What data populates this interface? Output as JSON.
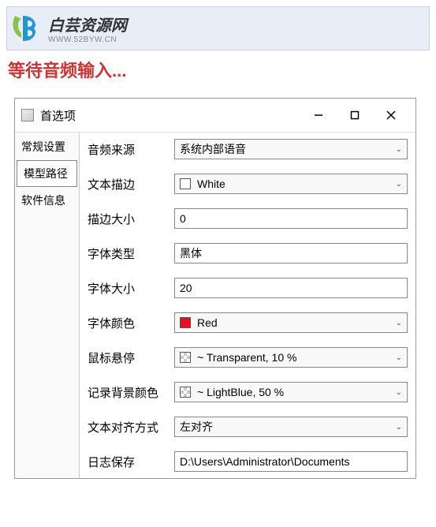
{
  "banner": {
    "logo_cn": "白芸资源网",
    "logo_url": "WWW.52BYW.CN"
  },
  "status": "等待音频输入...",
  "window": {
    "title": "首选项",
    "tabs": [
      "常规设置",
      "模型路径",
      "软件信息"
    ],
    "selected_tab": 1
  },
  "form": {
    "audio_source": {
      "label": "音频来源",
      "value": "系统内部语音"
    },
    "text_stroke": {
      "label": "文本描边",
      "value": "White",
      "color": "#ffffff"
    },
    "stroke_size": {
      "label": "描边大小",
      "value": "0"
    },
    "font_type": {
      "label": "字体类型",
      "value": "黑体"
    },
    "font_size": {
      "label": "字体大小",
      "value": "20"
    },
    "font_color": {
      "label": "字体颜色",
      "value": "Red",
      "color": "#e81123"
    },
    "hover": {
      "label": "鼠标悬停",
      "value": "~ Transparent, 10 %"
    },
    "bg_color": {
      "label": "记录背景颜色",
      "value": "~ LightBlue, 50 %"
    },
    "text_align": {
      "label": "文本对齐方式",
      "value": "左对齐"
    },
    "log_path": {
      "label": "日志保存",
      "value": "D:\\Users\\Administrator\\Documents"
    }
  }
}
